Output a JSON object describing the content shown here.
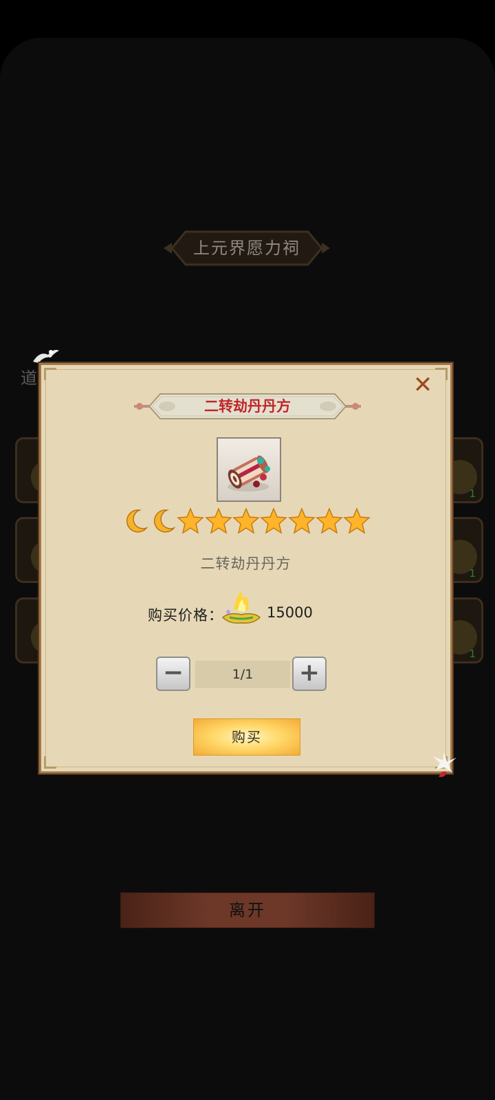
{
  "shop": {
    "title": "上元界愿力祠",
    "side_label": "道",
    "slot_counts": [
      "1",
      "1",
      "1"
    ]
  },
  "dialog": {
    "banner_title": "二转劫丹丹方",
    "close_icon": "close-icon",
    "item_icon": "pill-recipe-scroll-icon",
    "rating": {
      "moons": 2,
      "stars": 7
    },
    "item_name": "二转劫丹丹方",
    "price_label": "购买价格：",
    "currency_icon": "gold-ingot-icon",
    "price_value": "15000",
    "quantity": "1/1",
    "buy_label": "购买"
  },
  "footer": {
    "leave_label": "离开"
  },
  "colors": {
    "banner_text": "#c0262b",
    "panel_bg": "#e6d8b6",
    "buy_gold": "#ffd96a"
  }
}
